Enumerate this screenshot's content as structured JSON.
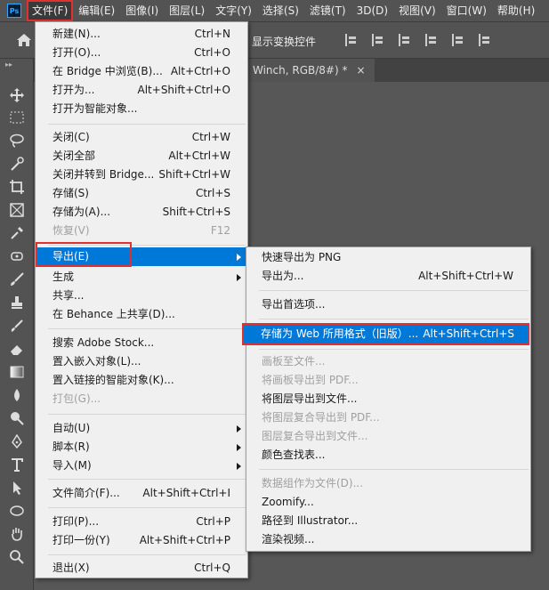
{
  "menubar": {
    "app_logo": "Ps",
    "items": [
      "文件(F)",
      "编辑(E)",
      "图像(I)",
      "图层(L)",
      "文字(Y)",
      "选择(S)",
      "滤镜(T)",
      "3D(D)",
      "视图(V)",
      "窗口(W)",
      "帮助(H)"
    ]
  },
  "options_bar": {
    "show_transform_controls": "显示变换控件"
  },
  "document_tab": {
    "title": "Winch, RGB/8#) *",
    "close": "×"
  },
  "file_menu": {
    "items": [
      {
        "label": "新建(N)...",
        "shortcut": "Ctrl+N"
      },
      {
        "label": "打开(O)...",
        "shortcut": "Ctrl+O"
      },
      {
        "label": "在 Bridge 中浏览(B)...",
        "shortcut": "Alt+Ctrl+O"
      },
      {
        "label": "打开为...",
        "shortcut": "Alt+Shift+Ctrl+O"
      },
      {
        "label": "打开为智能对象...",
        "shortcut": ""
      },
      {
        "label": "关闭(C)",
        "shortcut": "Ctrl+W"
      },
      {
        "label": "关闭全部",
        "shortcut": "Alt+Ctrl+W"
      },
      {
        "label": "关闭并转到 Bridge...",
        "shortcut": "Shift+Ctrl+W"
      },
      {
        "label": "存储(S)",
        "shortcut": "Ctrl+S"
      },
      {
        "label": "存储为(A)...",
        "shortcut": "Shift+Ctrl+S"
      },
      {
        "label": "恢复(V)",
        "shortcut": "F12"
      },
      {
        "label": "导出(E)",
        "shortcut": ""
      },
      {
        "label": "生成",
        "shortcut": ""
      },
      {
        "label": "共享...",
        "shortcut": ""
      },
      {
        "label": "在 Behance 上共享(D)...",
        "shortcut": ""
      },
      {
        "label": "搜索 Adobe Stock...",
        "shortcut": ""
      },
      {
        "label": "置入嵌入对象(L)...",
        "shortcut": ""
      },
      {
        "label": "置入链接的智能对象(K)...",
        "shortcut": ""
      },
      {
        "label": "打包(G)...",
        "shortcut": ""
      },
      {
        "label": "自动(U)",
        "shortcut": ""
      },
      {
        "label": "脚本(R)",
        "shortcut": ""
      },
      {
        "label": "导入(M)",
        "shortcut": ""
      },
      {
        "label": "文件简介(F)...",
        "shortcut": "Alt+Shift+Ctrl+I"
      },
      {
        "label": "打印(P)...",
        "shortcut": "Ctrl+P"
      },
      {
        "label": "打印一份(Y)",
        "shortcut": "Alt+Shift+Ctrl+P"
      },
      {
        "label": "退出(X)",
        "shortcut": "Ctrl+Q"
      }
    ]
  },
  "export_menu": {
    "items": [
      {
        "label": "快速导出为 PNG",
        "shortcut": ""
      },
      {
        "label": "导出为...",
        "shortcut": "Alt+Shift+Ctrl+W"
      },
      {
        "label": "导出首选项...",
        "shortcut": ""
      },
      {
        "label": "存储为 Web 所用格式（旧版）...",
        "shortcut": "Alt+Shift+Ctrl+S"
      },
      {
        "label": "画板至文件...",
        "shortcut": ""
      },
      {
        "label": "将画板导出到 PDF...",
        "shortcut": ""
      },
      {
        "label": "将图层导出到文件...",
        "shortcut": ""
      },
      {
        "label": "将图层复合导出到 PDF...",
        "shortcut": ""
      },
      {
        "label": "图层复合导出到文件...",
        "shortcut": ""
      },
      {
        "label": "颜色查找表...",
        "shortcut": ""
      },
      {
        "label": "数据组作为文件(D)...",
        "shortcut": ""
      },
      {
        "label": "Zoomify...",
        "shortcut": ""
      },
      {
        "label": "路径到 Illustrator...",
        "shortcut": ""
      },
      {
        "label": "渲染视频...",
        "shortcut": ""
      }
    ]
  },
  "colors": {
    "highlight": "#0078d7",
    "annotation_red": "#e03030",
    "menu_bg": "#f0f0f0",
    "ui_bg": "#535353"
  }
}
